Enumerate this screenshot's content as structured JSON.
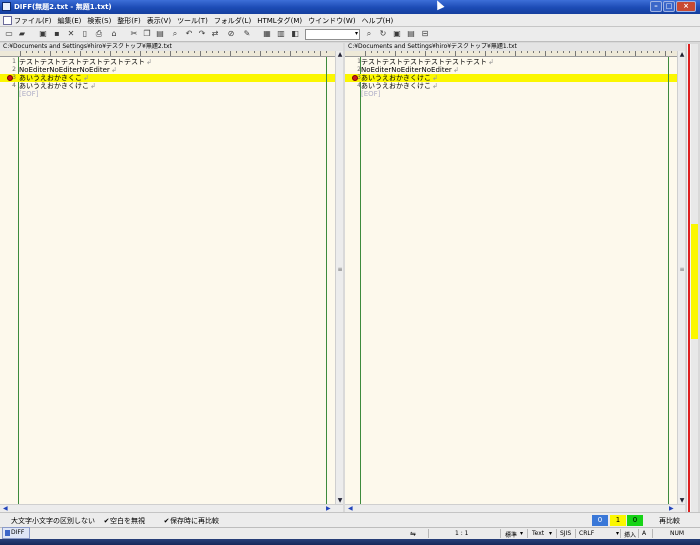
{
  "window": {
    "title": "DIFF(無題2.txt - 無題1.txt)",
    "controls": [
      "minimize-icon",
      "maximize-icon",
      "close-icon"
    ]
  },
  "menu": [
    "ファイル(F)",
    "編集(E)",
    "検索(S)",
    "整形(F)",
    "表示(V)",
    "ツール(T)",
    "フォルダ(L)",
    "HTMLタグ(M)",
    "ウインドウ(W)",
    "ヘルプ(H)"
  ],
  "toolbar": {
    "icons": [
      "new-file-icon",
      "open-folder-icon",
      "save-icon",
      "cut-icon",
      "new-doc-icon",
      "print-icon",
      "lock-icon",
      "undo-icon",
      "copy-icon",
      "paste-icon",
      "find-icon",
      "replace-icon",
      "redo-icon",
      "tag-icon",
      "pen-icon",
      "grid-icon",
      "book-icon",
      "refresh-icon",
      "window-icon",
      "layout-icon",
      "split-icon"
    ],
    "combo_value": ""
  },
  "left_pane": {
    "path": "C:¥Documents and Settings¥hiro¥デスクトップ¥無題2.txt",
    "lines": [
      {
        "num": "1",
        "text": "テストテストテストテストテストテスト",
        "highlight": false,
        "marker": false
      },
      {
        "num": "2",
        "text": "NoEditerNoEditerNoEditer",
        "highlight": false,
        "marker": false
      },
      {
        "num": "3",
        "text": "あいうえおかきくこ",
        "highlight": true,
        "marker": true
      },
      {
        "num": "4",
        "text": "あいうえおかきくけこ",
        "highlight": false,
        "marker": false
      },
      {
        "num": "",
        "text": "[EOF]",
        "highlight": false,
        "marker": false
      }
    ]
  },
  "right_pane": {
    "path": "C:¥Documents and Settings¥hiro¥デスクトップ¥無題1.txt",
    "lines": [
      {
        "num": "1",
        "text": "テストテストテストテストテストテスト",
        "highlight": false,
        "marker": false
      },
      {
        "num": "2",
        "text": "NoEditerNoEditerNoEditer",
        "highlight": false,
        "marker": false
      },
      {
        "num": "3",
        "text": "あいうえおかきくけこ",
        "highlight": true,
        "marker": true
      },
      {
        "num": "4",
        "text": "あいうえおかきくけこ",
        "highlight": false,
        "marker": false
      },
      {
        "num": "",
        "text": "[EOF]",
        "highlight": false,
        "marker": false
      }
    ]
  },
  "options": {
    "opt1": "大文字小文字の区別しない",
    "opt2": "空白を無視",
    "opt3": "保存時に再比較",
    "count_blue": "0",
    "count_yellow": "1",
    "count_green": "0",
    "recompare": "再比較",
    "colors": {
      "blue": "#3a78d8",
      "yellow": "#fbf700",
      "green": "#17d417"
    }
  },
  "status": {
    "taskbar_item": "DIFF",
    "position": "1 : 1",
    "mode": "標準",
    "filetype": "Text",
    "encoding": "SJIS",
    "lineend": "CRLF",
    "insert": "挿入",
    "a": "A",
    "num": "NUM"
  },
  "diffmap": {
    "highlight_color": "#fbf700",
    "line_color": "#dd2020"
  }
}
